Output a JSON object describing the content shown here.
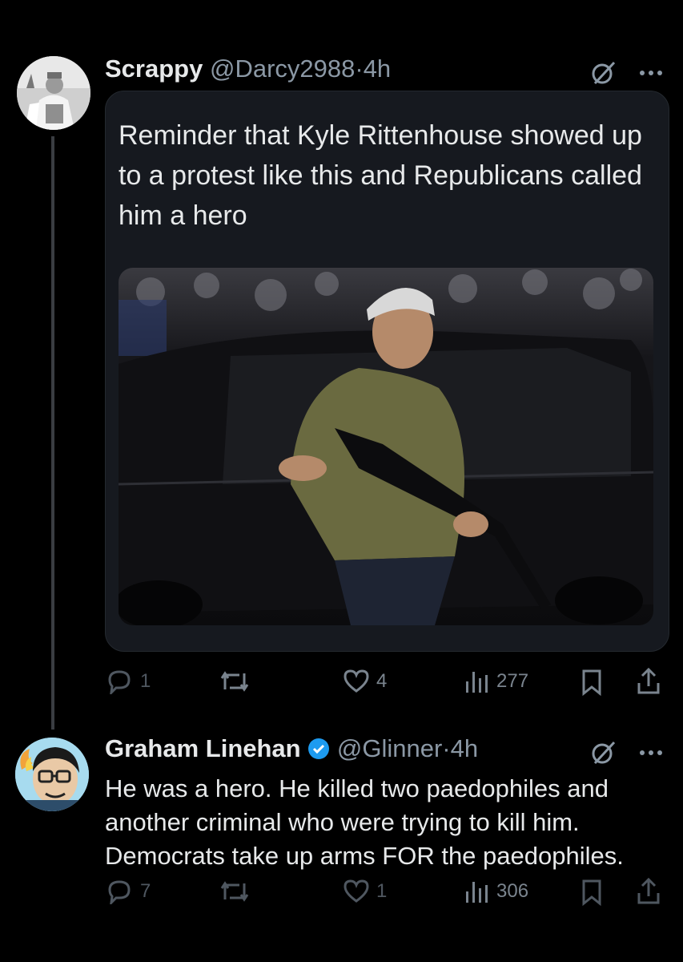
{
  "tweet1": {
    "name": "Scrappy",
    "handle": "@Darcy2988",
    "dot": "·",
    "time": "4h",
    "text": "Reminder that Kyle Rittenhouse showed up to a protest like this and Republicans called him a hero",
    "actions": {
      "replies": "1",
      "likes": "4",
      "views": "277"
    }
  },
  "tweet2": {
    "name": "Graham Linehan",
    "handle": "@Glinner",
    "dot": "·",
    "time": "4h",
    "text": "He was a hero. He killed two paedophiles and another criminal who were trying to kill him. Democrats take up arms FOR the paedophiles.",
    "actions": {
      "replies": "7",
      "likes": "1",
      "views": "306"
    }
  },
  "icons": [
    "grok-icon",
    "more-icon",
    "reply-icon",
    "retweet-icon",
    "like-icon",
    "views-icon",
    "bookmark-icon",
    "share-icon",
    "verified-badge-icon"
  ],
  "colors": {
    "background": "#000000",
    "card": "#16191f",
    "muted": "#8b98a5",
    "verified": "#1d9bf0"
  }
}
